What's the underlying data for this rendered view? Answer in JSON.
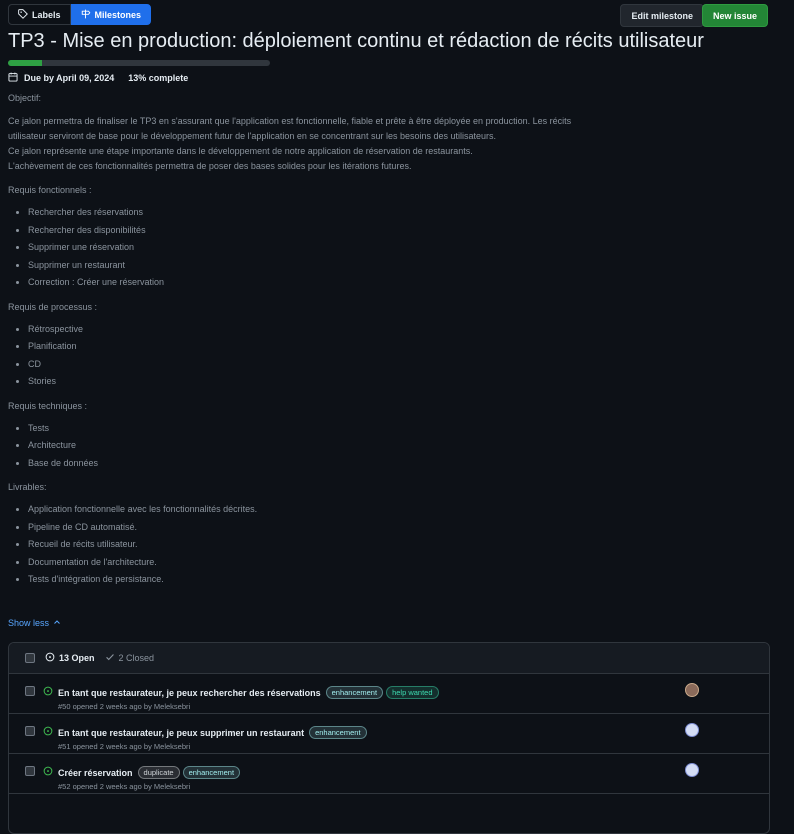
{
  "toolbar": {
    "labels": "Labels",
    "milestones": "Milestones",
    "edit_milestone": "Edit milestone",
    "new_issue": "New issue"
  },
  "milestone": {
    "title": "TP3 - Mise en production: déploiement continu et rédaction de récits utilisateur",
    "progress_fraction": 0.13,
    "due": "Due by April 09, 2024",
    "complete": "13% complete"
  },
  "description": {
    "objective_label": "Objectif:",
    "para1": "Ce jalon permettra de finaliser le TP3 en s'assurant que l'application est fonctionnelle, fiable et prête à être déployée en production. Les récits utilisateur serviront de base pour le développement futur de l'application en se concentrant sur les besoins des utilisateurs.",
    "para2a": "Ce jalon représente une étape importante dans le développement de notre application de réservation de restaurants.",
    "para2b": "L'achèvement de ces fonctionnalités permettra de poser des bases solides pour les itérations futures.",
    "functional_label": "Requis fonctionnels :",
    "functional": [
      "Rechercher des réservations",
      "Rechercher des disponibilités",
      "Supprimer une réservation",
      "Supprimer un restaurant",
      "Correction : Créer une réservation"
    ],
    "process_label": "Requis de processus :",
    "process": [
      "Rétrospective",
      "Planification",
      "CD",
      "Stories"
    ],
    "technical_label": "Requis techniques :",
    "technical": [
      "Tests",
      "Architecture",
      "Base de données"
    ],
    "deliverables_label": "Livrables:",
    "deliverables": [
      "Application fonctionnelle avec les fonctionnalités décrites.",
      "Pipeline de CD automatisé.",
      "Recueil de récits utilisateur.",
      "Documentation de l'architecture.",
      "Tests d'intégration de persistance."
    ]
  },
  "show_less": "Show less",
  "issues": {
    "open_count": "13 Open",
    "closed_count": "2 Closed",
    "rows": [
      {
        "title": "En tant que restaurateur, je peux rechercher des réservations",
        "labels": [
          {
            "text": "enhancement",
            "color": "#a2eeef"
          },
          {
            "text": "help wanted",
            "color": "#008672"
          }
        ],
        "meta": "#50 opened 2 weeks ago by Meleksebri"
      },
      {
        "title": "En tant que restaurateur, je peux supprimer un restaurant",
        "labels": [
          {
            "text": "enhancement",
            "color": "#a2eeef"
          }
        ],
        "meta": "#51 opened 2 weeks ago by Meleksebri"
      },
      {
        "title": "Créer réservation",
        "labels": [
          {
            "text": "duplicate",
            "color": "#cfd3d7"
          },
          {
            "text": "enhancement",
            "color": "#a2eeef"
          }
        ],
        "meta": "#52 opened 2 weeks ago by Meleksebri"
      }
    ]
  },
  "colors": {
    "accent": "#1f6feb",
    "success": "#238636",
    "open_icon": "#3fb950"
  }
}
